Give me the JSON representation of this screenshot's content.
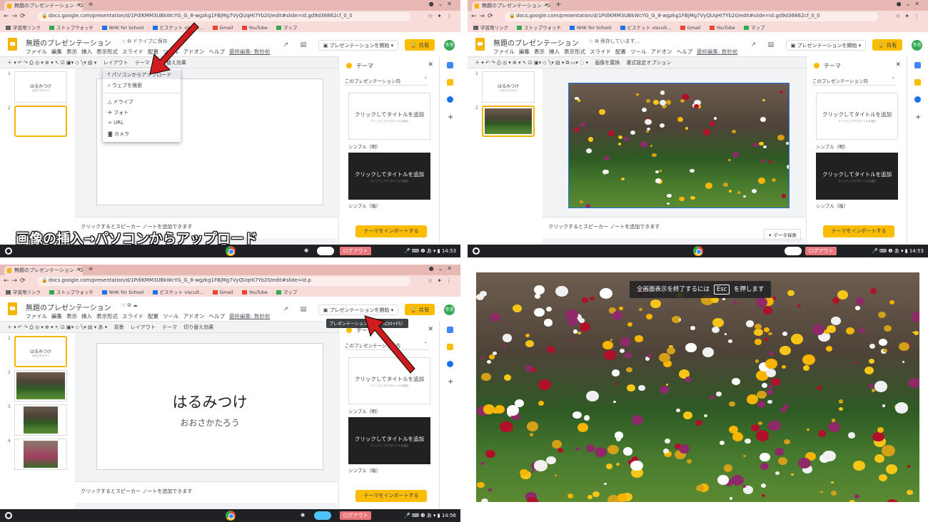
{
  "browser": {
    "tab_title": "無題のプレゼンテーション - G",
    "url_q1": "docs.google.com/presentation/d/1PdlKMM3UBkWcYG_G_8-wgzkg1FBjMg7VyQUqHI7Yb20/edit#slide=id.gd9d36862cf_0_0",
    "url_q3": "docs.google.com/presentation/d/1PdlKMM3UBkWcYG_G_8-wgzkg1FBjMg7VyQUqHI7Yb20/edit#slide=id.p",
    "bookmarks": [
      {
        "label": "学習用リンク",
        "color": "#5f6368"
      },
      {
        "label": "ストップウォッチ",
        "color": "#34a853"
      },
      {
        "label": "NHK for School",
        "color": "#1a73e8"
      },
      {
        "label": "ビスケット viscuit...",
        "color": "#1a73e8"
      },
      {
        "label": "Gmail",
        "color": "#ea4335"
      },
      {
        "label": "YouTube",
        "color": "#ea4335"
      },
      {
        "label": "マップ",
        "color": "#34a853"
      }
    ]
  },
  "doc": {
    "title": "無題のプレゼンテーション",
    "status_q1": "ドライブに保存",
    "status_q2": "保存しています...",
    "menu": [
      "ファイル",
      "編集",
      "表示",
      "挿入",
      "表示形式",
      "スライド",
      "配置",
      "ツール",
      "アドオン",
      "ヘルプ"
    ],
    "last_edit": "最終編集: 数秒前",
    "present_label": "プレゼンテーションを開始",
    "share_label": "共有",
    "avatar": "幸茂"
  },
  "toolbar_q1": [
    "レイアウト",
    "テーマ",
    "切り替え効果"
  ],
  "toolbar_q2": [
    "画像を置換",
    "書式設定オプション"
  ],
  "toolbar_q3": [
    "背景",
    "レイアウト",
    "テーマ",
    "切り替え効果"
  ],
  "thumb_title": "はるみつけ",
  "thumb_sub": "おおさかたろう",
  "slide_title": "はるみつけ",
  "slide_sub": "おおさかたろう",
  "notes": "クリックするとスピーカー ノートを追加できます",
  "theme": {
    "header": "テーマ",
    "select": "このプレゼンテーション内",
    "card_title": "クリックしてタイトルを追加",
    "card_sub": "クリックしてサブタイトルを追加",
    "light": "シンプル（明）",
    "dark": "シンプル（暗）",
    "import": "テーマをインポートする",
    "explore": "データ探索"
  },
  "insert_menu": {
    "upload": "パソコンからアップロード",
    "web": "ウェブを検索",
    "drive": "ドライブ",
    "photos": "フォト",
    "url": "URL",
    "camera": "カメラ"
  },
  "caption": "画像の挿入→パソコンからアップロード",
  "tooltip": "プレゼンテーションを開始（Ctrl+F5）",
  "fullscreen_msg_pre": "全画面表示を終了するには",
  "fullscreen_key": "Esc",
  "fullscreen_msg_post": "を押します",
  "shelf": {
    "logout": "ログアウト",
    "time_q1": "14:53",
    "time_q2": "14:53",
    "time_q3": "14:56",
    "ime": "あ"
  },
  "slide_numbers": [
    "1",
    "2",
    "3",
    "4"
  ],
  "colors": {
    "accent": "#fbbc04",
    "present_arrow": "#d01c1f",
    "logout": "#e8767a"
  }
}
